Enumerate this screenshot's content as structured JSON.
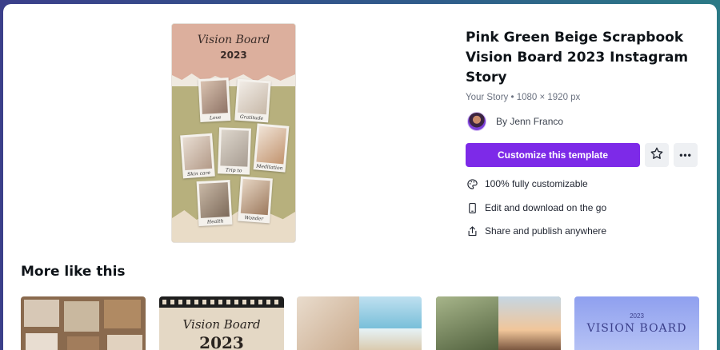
{
  "template": {
    "title": "Pink Green Beige Scrapbook Vision Board 2023 Instagram Story",
    "meta": "Your Story • 1080 × 1920 px",
    "author": "By Jenn Franco",
    "customize_label": "Customize this template",
    "more_label": "•••"
  },
  "preview": {
    "title": "Vision Board",
    "year": "2023",
    "captions": [
      "Love",
      "Gratitude",
      "Skin care",
      "Trip to",
      "Meditation",
      "Health",
      "Wonder"
    ]
  },
  "features": [
    {
      "icon": "palette-icon",
      "label": "100% fully customizable"
    },
    {
      "icon": "phone-icon",
      "label": "Edit and download on the go"
    },
    {
      "icon": "share-icon",
      "label": "Share and publish anywhere"
    }
  ],
  "more_section": {
    "title": "More like this",
    "thumbs": [
      {
        "title": "",
        "year": ""
      },
      {
        "title": "Vision Board",
        "year": "2023"
      },
      {
        "title": "",
        "year": ""
      },
      {
        "title": "",
        "year": ""
      },
      {
        "title": "VISION BOARD",
        "year": "2023"
      }
    ]
  },
  "colors": {
    "accent": "#7d2ae8",
    "pink": "#dcaf9d",
    "green": "#b7b07d",
    "beige": "#e9dcc7"
  }
}
